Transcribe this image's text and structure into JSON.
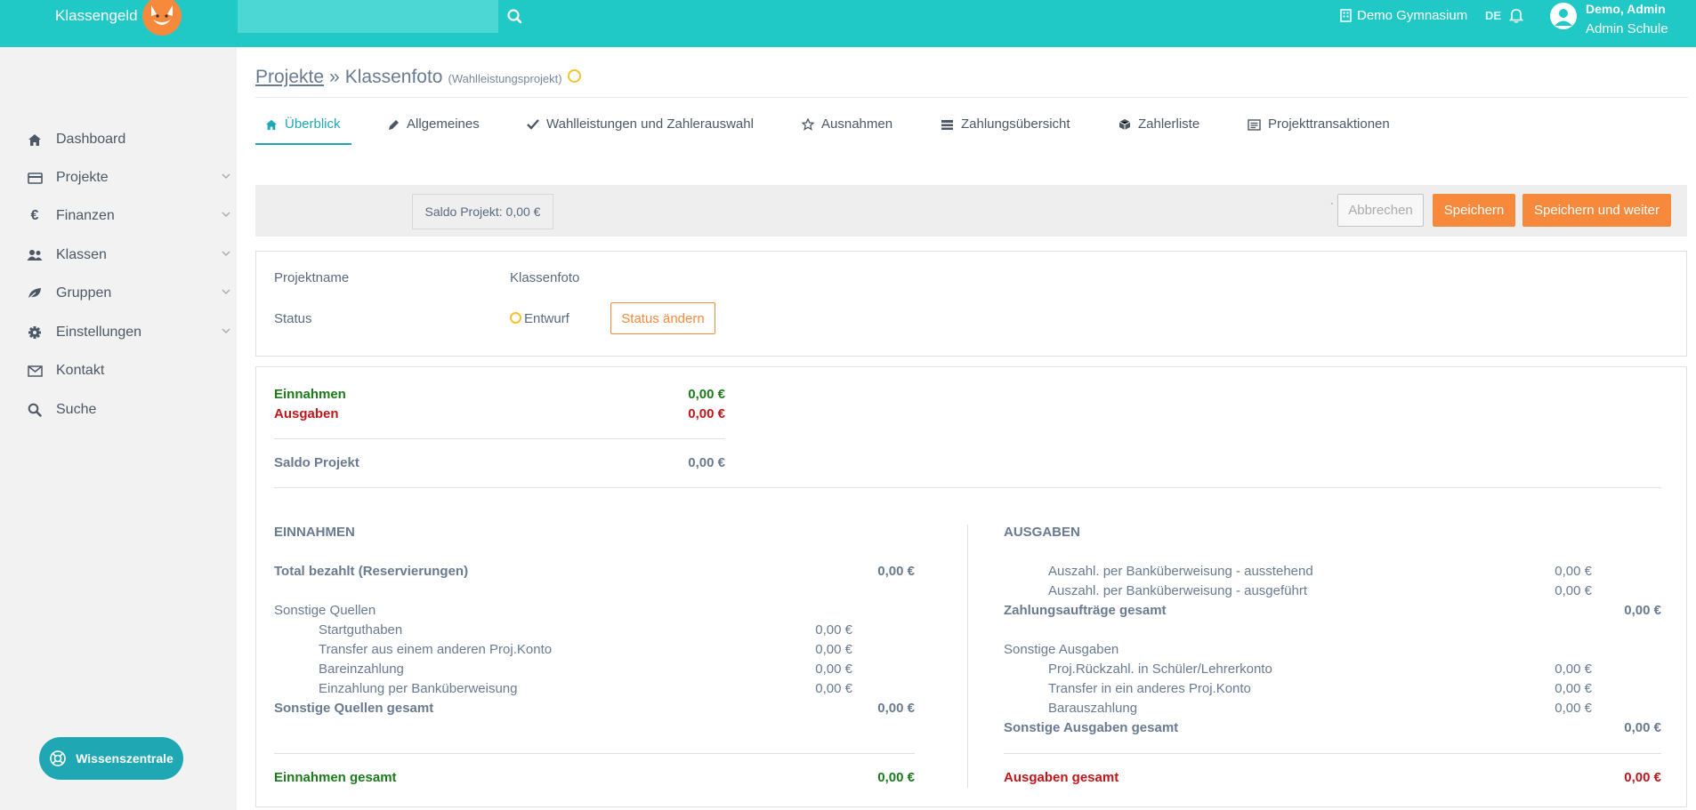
{
  "header": {
    "brand": "Klassengeld",
    "search_placeholder": "",
    "school": "Demo Gymnasium",
    "lang": "DE",
    "user_name": "Demo, Admin",
    "user_role": "Admin Schule",
    "accent": "#20c9c6"
  },
  "sidebar": {
    "items": [
      {
        "label": "Dashboard",
        "icon": "home-icon",
        "has_children": false
      },
      {
        "label": "Projekte",
        "icon": "credit-card-icon",
        "has_children": true
      },
      {
        "label": "Finanzen",
        "icon": "euro-icon",
        "has_children": true
      },
      {
        "label": "Klassen",
        "icon": "users-icon",
        "has_children": true
      },
      {
        "label": "Gruppen",
        "icon": "leaf-icon",
        "has_children": true
      },
      {
        "label": "Einstellungen",
        "icon": "gear-icon",
        "has_children": true
      },
      {
        "label": "Kontakt",
        "icon": "envelope-icon",
        "has_children": false
      },
      {
        "label": "Suche",
        "icon": "search-icon",
        "has_children": false
      }
    ],
    "help_button": "Wissenszentrale"
  },
  "breadcrumb": {
    "parent": "Projekte",
    "separator": "»",
    "current": "Klassenfoto",
    "type": "(Wahlleistungsprojekt)"
  },
  "tabs": [
    {
      "label": "Überblick",
      "icon": "home-icon",
      "active": true
    },
    {
      "label": "Allgemeines",
      "icon": "pencil-icon",
      "active": false
    },
    {
      "label": "Wahlleistungen und Zahlerauswahl",
      "icon": "check-icon",
      "active": false
    },
    {
      "label": "Ausnahmen",
      "icon": "star-icon",
      "active": false
    },
    {
      "label": "Zahlungsübersicht",
      "icon": "list-icon",
      "active": false
    },
    {
      "label": "Zahlerliste",
      "icon": "cube-icon",
      "active": false
    },
    {
      "label": "Projekttransaktionen",
      "icon": "ledger-icon",
      "active": false
    }
  ],
  "action_bar": {
    "saldo": "Saldo Projekt: 0,00 €",
    "tick": "`",
    "cancel": "Abbrechen",
    "save": "Speichern",
    "save_next": "Speichern und weiter"
  },
  "project_info": {
    "name_label": "Projektname",
    "name_value": "Klassenfoto",
    "status_label": "Status",
    "status_value": "Entwurf",
    "status_button": "Status ändern"
  },
  "summary": {
    "income_label": "Einnahmen",
    "income_value": "0,00 €",
    "expense_label": "Ausgaben",
    "expense_value": "0,00 €",
    "saldo_label": "Saldo Projekt",
    "saldo_value": "0,00 €"
  },
  "income": {
    "heading": "EINNAHMEN",
    "total_paid_label": "Total bezahlt (Reservierungen)",
    "total_paid_value": "0,00 €",
    "other_label": "Sonstige Quellen",
    "other_items": [
      {
        "label": "Startguthaben",
        "value": "0,00 €"
      },
      {
        "label": "Transfer aus einem anderen Proj.Konto",
        "value": "0,00 €"
      },
      {
        "label": "Bareinzahlung",
        "value": "0,00 €"
      },
      {
        "label": "Einzahlung per Banküberweisung",
        "value": "0,00 €"
      }
    ],
    "other_total_label": "Sonstige Quellen gesamt",
    "other_total_value": "0,00 €",
    "grand_label": "Einnahmen gesamt",
    "grand_value": "0,00 €"
  },
  "expenses": {
    "heading": "AUSGABEN",
    "transfer_items": [
      {
        "label": "Auszahl. per Banküberweisung - ausstehend",
        "value": "0,00 €"
      },
      {
        "label": "Auszahl. per Banküberweisung - ausgeführt",
        "value": "0,00 €"
      }
    ],
    "orders_total_label": "Zahlungsaufträge gesamt",
    "orders_total_value": "0,00 €",
    "other_label": "Sonstige Ausgaben",
    "other_items": [
      {
        "label": "Proj.Rückzahl. in Schüler/Lehrerkonto",
        "value": "0,00 €"
      },
      {
        "label": "Transfer in ein anderes Proj.Konto",
        "value": "0,00 €"
      },
      {
        "label": "Barauszahlung",
        "value": "0,00 €"
      }
    ],
    "other_total_label": "Sonstige Ausgaben gesamt",
    "other_total_value": "0,00 €",
    "grand_label": "Ausgaben gesamt",
    "grand_value": "0,00 €"
  }
}
